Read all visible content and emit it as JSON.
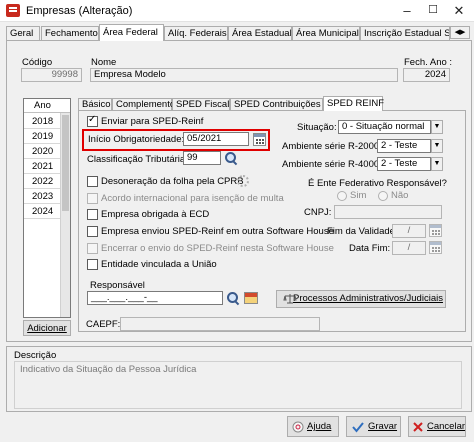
{
  "window": {
    "title": "Empresas (Alteração)",
    "minimize": "–",
    "maximize": "☐",
    "close": "✕"
  },
  "tabs": [
    {
      "label": "Geral"
    },
    {
      "label": "Fechamento"
    },
    {
      "label": "Área Federal"
    },
    {
      "label": "Alíq. Federais"
    },
    {
      "label": "Área Estadual"
    },
    {
      "label": "Área Municipal"
    },
    {
      "label": "Inscrição Estadual S"
    }
  ],
  "header": {
    "codigo_label": "Código",
    "codigo_value": "99998",
    "nome_label": "Nome",
    "nome_value": "Empresa Modelo",
    "fech_ano_label": "Fech. Ano :",
    "fech_ano_value": "2024"
  },
  "years": {
    "head": "Ano",
    "items": [
      "2018",
      "2019",
      "2020",
      "2021",
      "2022",
      "2023",
      "2024"
    ],
    "selected": "2024",
    "add_button": "Adicionar"
  },
  "subtabs": [
    {
      "label": "Básico"
    },
    {
      "label": "Complemento"
    },
    {
      "label": "SPED Fiscal"
    },
    {
      "label": "SPED Contribuições"
    },
    {
      "label": "SPED REINF"
    }
  ],
  "reinf": {
    "enviar_label": "Enviar para SPED-Reinf",
    "enviar_checked": true,
    "inicio_label": "Início Obrigatoriedade:",
    "inicio_value": "05/2021",
    "classificacao_label": "Classificação Tributária:",
    "classificacao_value": "99",
    "desoneracao_label": "Desoneração da folha pela CPRB",
    "acordo_label": "Acordo internacional para isenção de multa",
    "ecd_label": "Empresa obrigada à ECD",
    "enviou_label": "Empresa enviou SPED-Reinf em outra Software House",
    "encerrar_label": "Encerrar o envio do SPED-Reinf nesta Software House",
    "entidade_label": "Entidade vinculada a União",
    "situacao_label": "Situação:",
    "situacao_value": "0 - Situação normal",
    "amb2000_label": "Ambiente série R-2000:",
    "amb2000_value": "2 - Teste",
    "amb4000_label": "Ambiente série R-4000:",
    "amb4000_value": "2 - Teste",
    "ente_label": "É Ente Federativo Responsável?",
    "sim_label": "Sim",
    "nao_label": "Não",
    "cnpj_label": "CNPJ:",
    "validade_label": "Fim da Validade:",
    "validade_value": "/",
    "datafim_label": "Data Fim:",
    "datafim_value": "/",
    "responsavel_label": "Responsável",
    "responsavel_value": "___.___.___-__",
    "processos_button": "Processos Administrativos/Judiciais"
  },
  "caepf": {
    "label": "CAEPF:"
  },
  "description": {
    "label": "Descrição",
    "text": "Indicativo da Situação da Pessoa Jurídica"
  },
  "footer": {
    "ajuda": "Ajuda",
    "gravar": "Gravar",
    "cancelar": "Cancelar"
  },
  "colors": {
    "highlight": "#e00000",
    "window_bg": "#f0f0f0"
  }
}
